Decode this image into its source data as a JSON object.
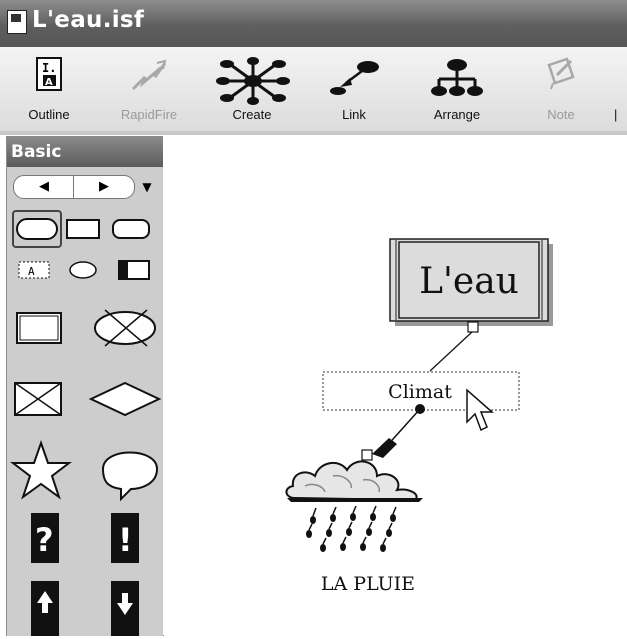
{
  "window": {
    "title": "L'eau.isf",
    "icon": "document-icon"
  },
  "toolbar": {
    "buttons": [
      {
        "label": "Outline",
        "icon": "outline-icon",
        "enabled": true
      },
      {
        "label": "RapidFire",
        "icon": "rapidfire-icon",
        "enabled": false
      },
      {
        "label": "Create",
        "icon": "create-icon",
        "enabled": true
      },
      {
        "label": "Link",
        "icon": "link-icon",
        "enabled": true
      },
      {
        "label": "Arrange",
        "icon": "arrange-icon",
        "enabled": true
      },
      {
        "label": "Note",
        "icon": "note-icon",
        "enabled": false
      }
    ]
  },
  "palette": {
    "title": "Basic",
    "nav": {
      "prev": "◀",
      "next": "▶",
      "menu": "▼"
    },
    "symbols": [
      "? ",
      "!"
    ]
  },
  "diagram": {
    "main_idea": "L'eau",
    "subtopic": "Climat",
    "symbol_label": "LA PLUIE"
  },
  "colors": {
    "titlebar": "#6b6b6b",
    "palette_bg": "#cdcdcd",
    "selection": "#555555"
  }
}
